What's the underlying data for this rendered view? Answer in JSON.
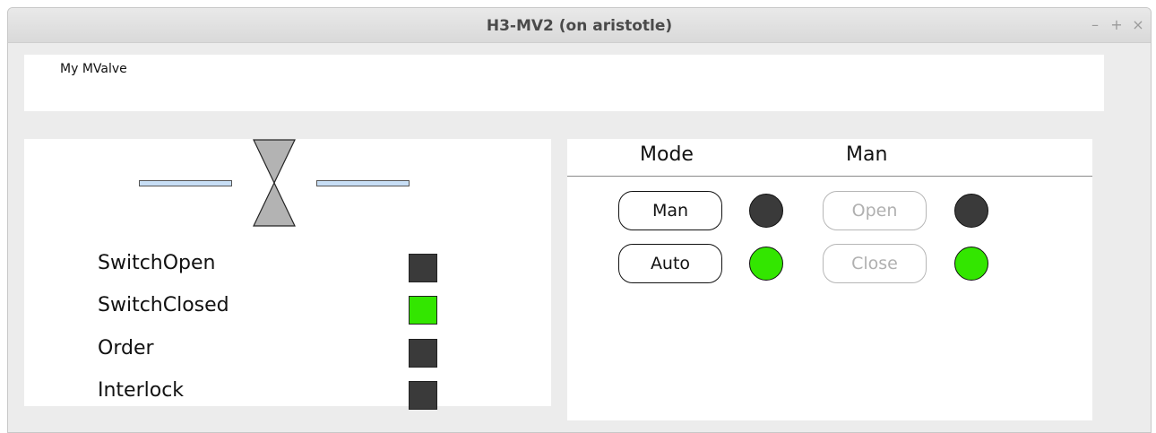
{
  "window": {
    "title": "H3-MV2 (on aristotle)",
    "controls": {
      "minimize": "–",
      "maximize": "+",
      "close": "×"
    }
  },
  "header": {
    "label": "My MValve"
  },
  "valve": {
    "pipe_color": "#c7def5",
    "body_color": "#b3b3b3"
  },
  "signals": [
    {
      "label": "SwitchOpen",
      "color": "#3a3a3a"
    },
    {
      "label": "SwitchClosed",
      "color": "#33e600"
    },
    {
      "label": "Order",
      "color": "#3a3a3a"
    },
    {
      "label": "Interlock",
      "color": "#3a3a3a"
    }
  ],
  "control_panel": {
    "columns": [
      "Mode",
      "Man"
    ],
    "mode_buttons": [
      {
        "label": "Man",
        "indicator_color": "#3a3a3a",
        "enabled": true
      },
      {
        "label": "Auto",
        "indicator_color": "#33e600",
        "enabled": true
      }
    ],
    "man_buttons": [
      {
        "label": "Open",
        "indicator_color": "#3a3a3a",
        "enabled": false
      },
      {
        "label": "Close",
        "indicator_color": "#33e600",
        "enabled": false
      }
    ]
  }
}
